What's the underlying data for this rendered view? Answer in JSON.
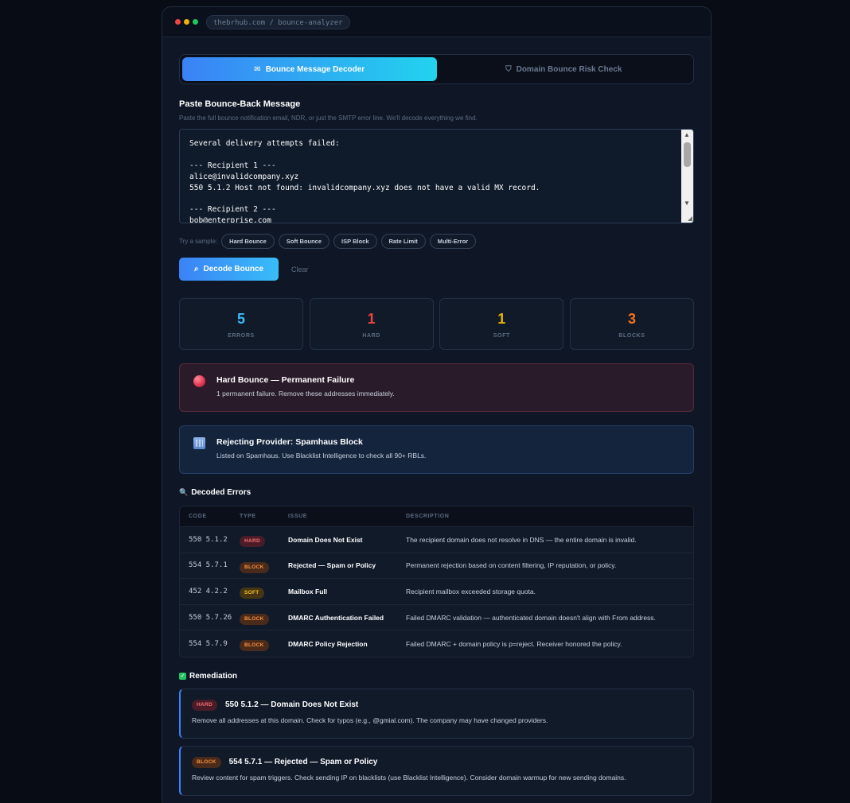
{
  "url": "thebrhub.com / bounce-analyzer",
  "colors": {
    "accent": "#3b82f6",
    "hard": "#ef4444",
    "soft": "#eab308",
    "block": "#f97316",
    "errors": "#38bdf8"
  },
  "tabs": [
    {
      "label": "Bounce Message Decoder",
      "icon": "envelope-icon",
      "active": true
    },
    {
      "label": "Domain Bounce Risk Check",
      "icon": "shield-icon",
      "active": false
    }
  ],
  "input": {
    "label": "Paste Bounce-Back Message",
    "hint": "Paste the full bounce notification email, NDR, or just the SMTP error line. We'll decode everything we find.",
    "value": "Several delivery attempts failed:\n\n--- Recipient 1 ---\nalice@invalidcompany.xyz\n550 5.1.2 Host not found: invalidcompany.xyz does not have a valid MX record.\n\n--- Recipient 2 ---\nbob@enterprise.com"
  },
  "samples": {
    "label": "Try a sample:",
    "items": [
      "Hard Bounce",
      "Soft Bounce",
      "ISP Block",
      "Rate Limit",
      "Multi-Error"
    ]
  },
  "actions": {
    "decode": "Decode Bounce",
    "clear": "Clear"
  },
  "stats": [
    {
      "value": "5",
      "label": "ERRORS",
      "color": "#38bdf8"
    },
    {
      "value": "1",
      "label": "HARD",
      "color": "#ef4444"
    },
    {
      "value": "1",
      "label": "SOFT",
      "color": "#eab308"
    },
    {
      "value": "3",
      "label": "BLOCKS",
      "color": "#f97316"
    }
  ],
  "alerts": {
    "hard": {
      "title": "Hard Bounce — Permanent Failure",
      "text": "1 permanent failure. Remove these addresses immediately."
    },
    "provider": {
      "title": "Rejecting Provider: Spamhaus Block",
      "text": "Listed on Spamhaus. Use Blacklist Intelligence to check all 90+ RBLs."
    }
  },
  "decoded": {
    "title": "Decoded Errors",
    "headers": [
      "CODE",
      "TYPE",
      "ISSUE",
      "DESCRIPTION"
    ],
    "rows": [
      {
        "code": "550 5.1.2",
        "type": "HARD",
        "issue": "Domain Does Not Exist",
        "description": "The recipient domain does not resolve in DNS — the entire domain is invalid."
      },
      {
        "code": "554 5.7.1",
        "type": "BLOCK",
        "issue": "Rejected — Spam or Policy",
        "description": "Permanent rejection based on content filtering, IP reputation, or policy."
      },
      {
        "code": "452 4.2.2",
        "type": "SOFT",
        "issue": "Mailbox Full",
        "description": "Recipient mailbox exceeded storage quota."
      },
      {
        "code": "550 5.7.26",
        "type": "BLOCK",
        "issue": "DMARC Authentication Failed",
        "description": "Failed DMARC validation — authenticated domain doesn't align with From address."
      },
      {
        "code": "554 5.7.9",
        "type": "BLOCK",
        "issue": "DMARC Policy Rejection",
        "description": "Failed DMARC + domain policy is p=reject. Receiver honored the policy."
      }
    ]
  },
  "remediation": {
    "title": "Remediation",
    "items": [
      {
        "type": "HARD",
        "title": "550 5.1.2 — Domain Does Not Exist",
        "text": "Remove all addresses at this domain. Check for typos (e.g., @gmial.com). The company may have changed providers."
      },
      {
        "type": "BLOCK",
        "title": "554 5.7.1 — Rejected — Spam or Policy",
        "text": "Review content for spam triggers. Check sending IP on blacklists (use Blacklist Intelligence). Consider domain warmup for new sending domains."
      }
    ]
  }
}
